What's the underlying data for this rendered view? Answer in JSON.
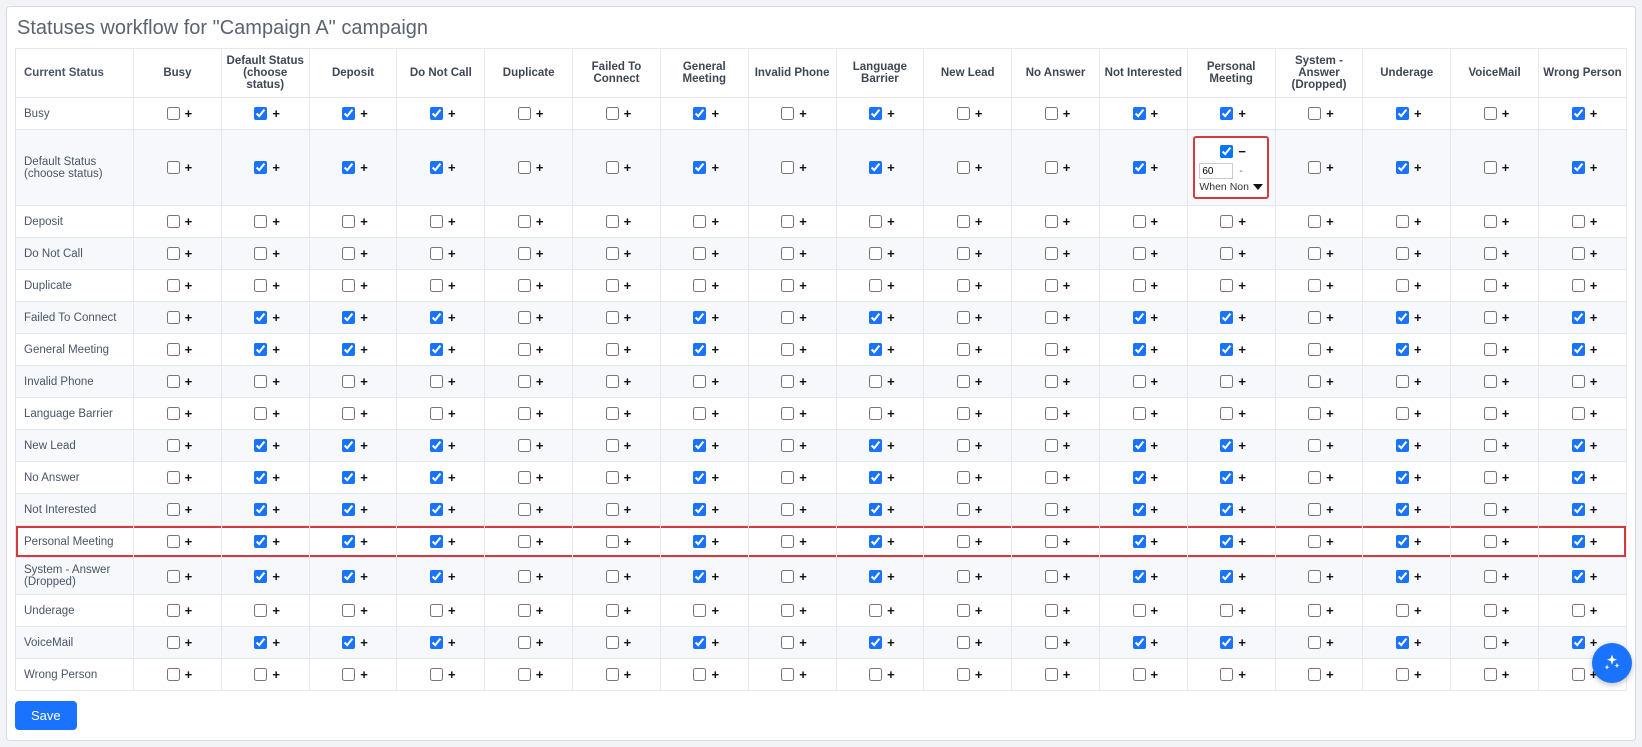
{
  "title": "Statuses workflow for \"Campaign A\" campaign",
  "save_label": "Save",
  "row_header_label": "Current Status",
  "columns": [
    "Busy",
    "Default Status (choose status)",
    "Deposit",
    "Do Not Call",
    "Duplicate",
    "Failed To Connect",
    "General Meeting",
    "Invalid Phone",
    "Language Barrier",
    "New Lead",
    "No Answer",
    "Not Interested",
    "Personal Meeting",
    "System - Answer (Dropped)",
    "Underage",
    "VoiceMail",
    "Wrong Person"
  ],
  "rows": [
    "Busy",
    "Default Status (choose status)",
    "Deposit",
    "Do Not Call",
    "Duplicate",
    "Failed To Connect",
    "General Meeting",
    "Invalid Phone",
    "Language Barrier",
    "New Lead",
    "No Answer",
    "Not Interested",
    "Personal Meeting",
    "System - Answer (Dropped)",
    "Underage",
    "VoiceMail",
    "Wrong Person"
  ],
  "pattern_checked_cols": [
    1,
    2,
    3,
    6,
    8,
    11,
    12,
    14,
    16
  ],
  "pattern_checked_rows": [
    0,
    1,
    5,
    6,
    9,
    10,
    11,
    12,
    13,
    15
  ],
  "all_unchecked_rows": [
    2,
    3,
    4,
    7,
    8,
    14,
    16
  ],
  "highlight_row_index": 12,
  "expanded_cell": {
    "row": 1,
    "col": 12,
    "value": "60",
    "dash": "-",
    "select_label": "When Non"
  }
}
